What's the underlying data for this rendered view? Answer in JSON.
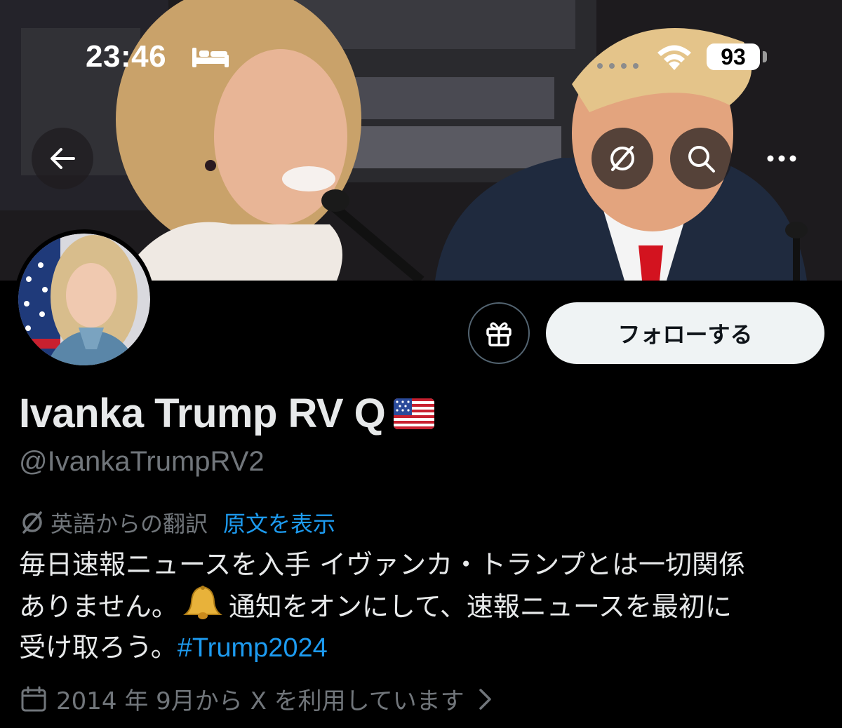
{
  "status_bar": {
    "time": "23:46",
    "battery": "93",
    "focus_icon": "bed-icon",
    "wifi_icon": "wifi-icon"
  },
  "banner": {
    "description_icon": "banner-photo",
    "nav": {
      "back_icon": "arrow-left-icon",
      "translate_icon": "translate-slash-icon",
      "search_icon": "search-icon",
      "more_icon": "more-icon"
    }
  },
  "profile": {
    "display_name": "Ivanka Trump RV Q",
    "flag": "us-flag-emoji",
    "handle": "@IvankaTrumpRV2",
    "gift_icon": "gift-icon",
    "follow_label": "フォローする"
  },
  "translation": {
    "label": "英語からの翻訳",
    "show_original": "原文を表示"
  },
  "bio": {
    "line1": "毎日速報ニュースを入手 イヴァンカ・トランプとは一切関係",
    "line2_a": "ありません。",
    "line2_b": "通知をオンにして、速報ニュースを最初に",
    "line3_a": "受け取ろう。",
    "hashtag": "#Trump2024"
  },
  "joined": {
    "text": "2014 年 9月から X を利用しています"
  },
  "colors": {
    "background": "#000000",
    "text_primary": "#e7e9ea",
    "text_secondary": "#71767b",
    "link": "#1d9bf0",
    "follow_bg": "#eff3f4"
  }
}
